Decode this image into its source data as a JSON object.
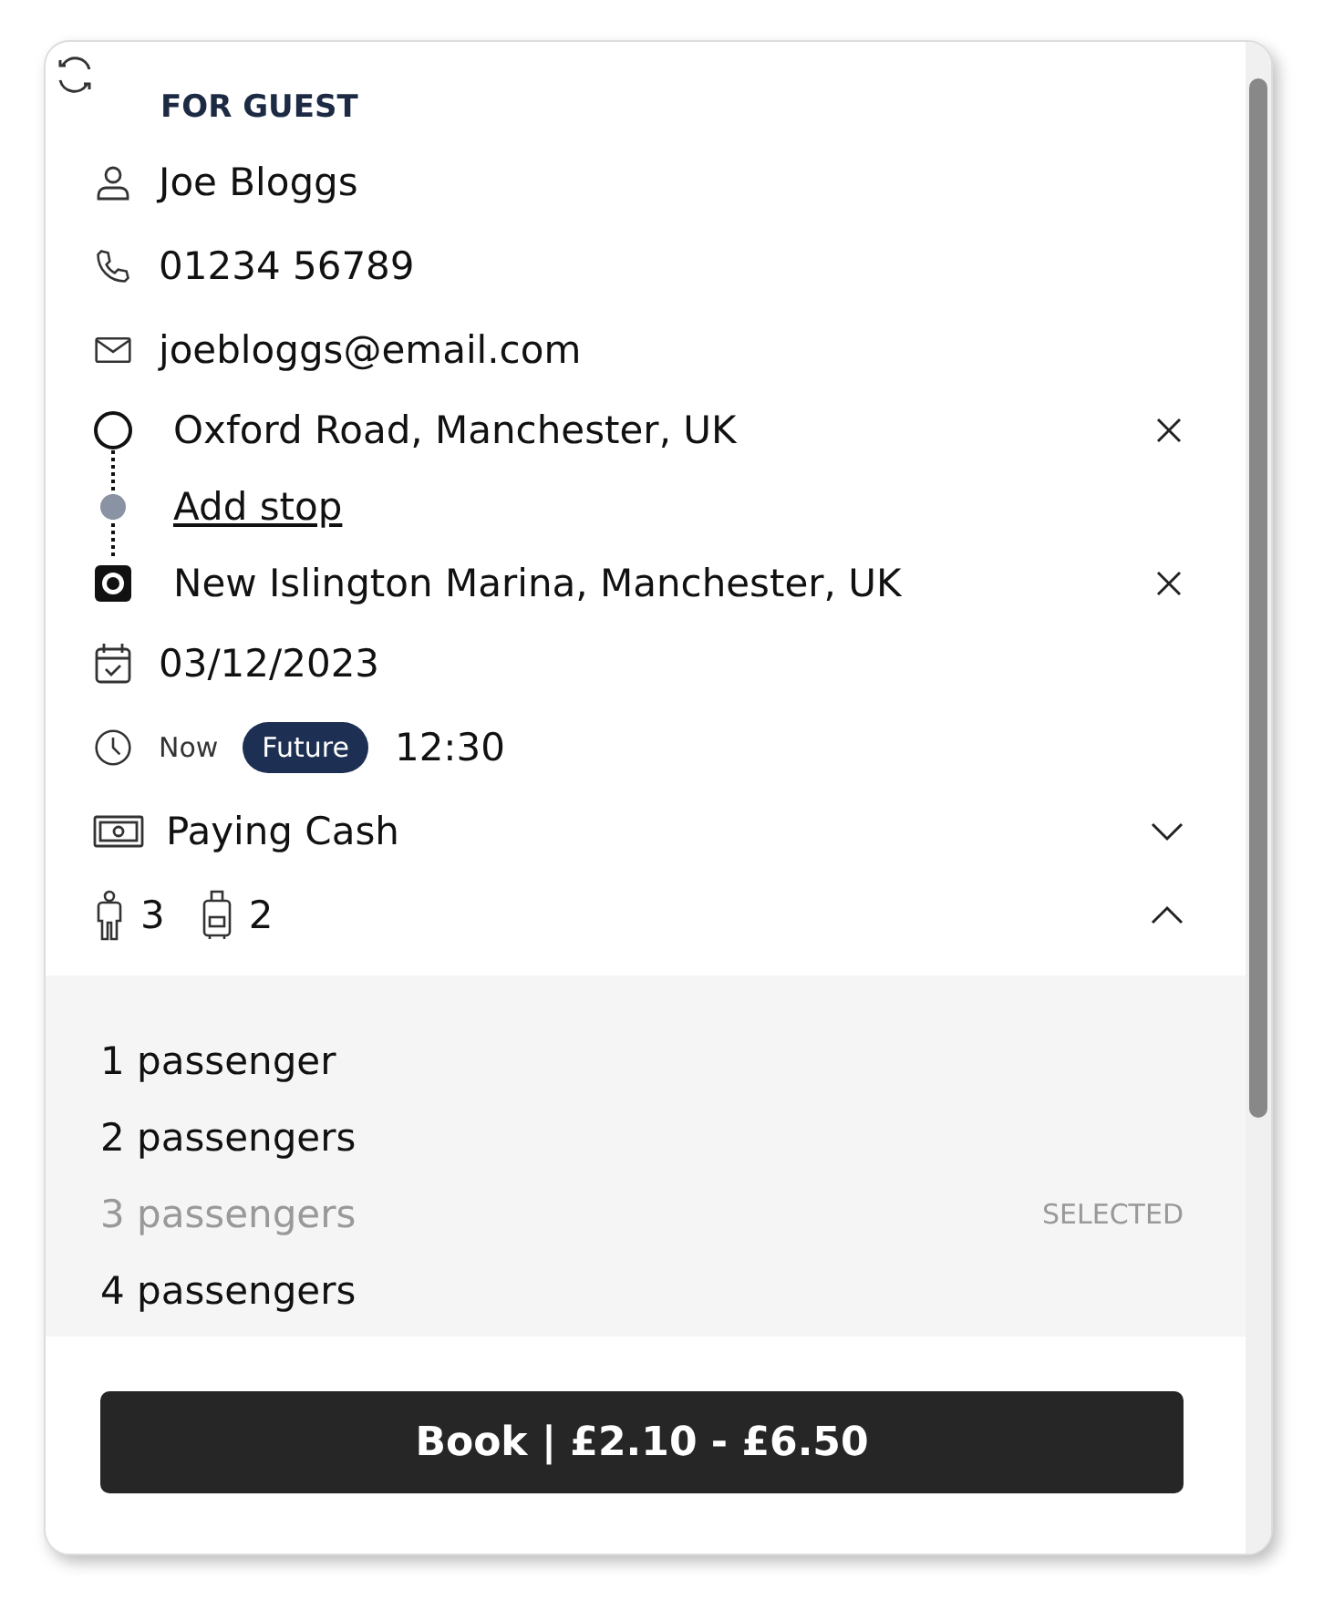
{
  "heading": "FOR GUEST",
  "contact": {
    "name": "Joe Bloggs",
    "phone": "01234 56789",
    "email": "joebloggs@email.com"
  },
  "route": [
    {
      "kind": "origin",
      "text": "Oxford Road, Manchester, UK"
    },
    {
      "kind": "add",
      "text": "Add stop"
    },
    {
      "kind": "destination",
      "text": "New Islington Marina, Manchester, UK"
    }
  ],
  "date": "03/12/2023",
  "time_modes": [
    {
      "label": "Now",
      "selected": false
    },
    {
      "label": "Future",
      "selected": true
    }
  ],
  "time": "12:30",
  "payment": {
    "label": "Paying Cash",
    "expanded": false
  },
  "passengers": {
    "count": "3",
    "luggage": "2",
    "expanded": true,
    "selected_label": "SELECTED",
    "options": [
      {
        "label": "1 passenger",
        "selected": false
      },
      {
        "label": "2 passengers",
        "selected": false
      },
      {
        "label": "3 passengers",
        "selected": true
      },
      {
        "label": "4 passengers",
        "selected": false
      }
    ]
  },
  "book_button": "Book | £2.10 - £6.50"
}
